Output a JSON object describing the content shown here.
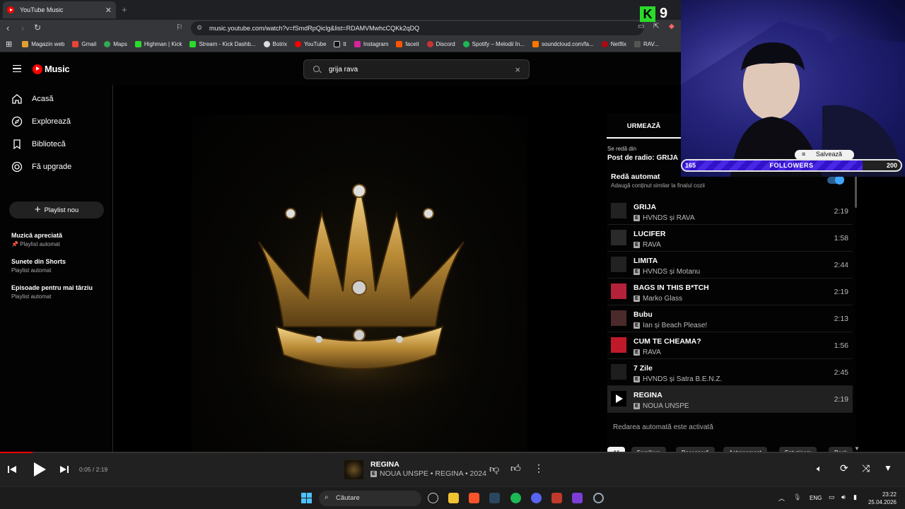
{
  "browser": {
    "tab_title": "YouTube Music",
    "url": "music.youtube.com/watch?v=fSmdRpQiclg&list=RDAMVMwhcCQKk2qDQ",
    "bookmarks": [
      "Magazin web",
      "Gmail",
      "Maps",
      "Highman | Kick",
      "Stream - Kick Dashb...",
      "Botrix",
      "YouTube",
      "tt",
      "Instagram",
      "faceit",
      "Discord",
      "Spotify – Melodii în...",
      "soundcloud.com/fa...",
      "Netflix",
      "RAV..."
    ]
  },
  "header": {
    "logo_text": "Music",
    "search_value": "grija rava",
    "search_clear": "×"
  },
  "sidebar": {
    "items": [
      {
        "label": "Acasă",
        "icon": "home-icon"
      },
      {
        "label": "Explorează",
        "icon": "compass-icon"
      },
      {
        "label": "Bibliotecă",
        "icon": "library-icon"
      },
      {
        "label": "Fă upgrade",
        "icon": "upgrade-icon"
      }
    ],
    "new_playlist": "Playlist nou",
    "playlists": [
      {
        "title": "Muzică apreciată",
        "subtitle": "Playlist automat",
        "pinned": true
      },
      {
        "title": "Sunete din Shorts",
        "subtitle": "Playlist automat"
      },
      {
        "title": "Episoade pentru mai târziu",
        "subtitle": "Playlist automat"
      }
    ]
  },
  "queue": {
    "tab": "URMEAZĂ",
    "playing_from_label": "Se redă din",
    "station": "Post de radio: GRIJA",
    "autoplay_title": "Redă automat",
    "autoplay_desc": "Adaugă conținut similar la finalul cozii",
    "autoplay_on": true,
    "tracks": [
      {
        "title": "GRIJA",
        "artist": "HVNDS și RAVA",
        "duration": "2:19"
      },
      {
        "title": "LUCIFER",
        "artist": "RAVA",
        "duration": "1:58"
      },
      {
        "title": "LIMITA",
        "artist": "HVNDS și Motanu",
        "duration": "2:44"
      },
      {
        "title": "BAGS IN THIS B*TCH",
        "artist": "Marko Glass",
        "duration": "2:19"
      },
      {
        "title": "Bubu",
        "artist": "Ian și Beach Please!",
        "duration": "2:13"
      },
      {
        "title": "CUM TE CHEAMA?",
        "artist": "RAVA",
        "duration": "1:56"
      },
      {
        "title": "7 Zile",
        "artist": "HVNDS și Satra B.E.N.Z.",
        "duration": "2:45"
      },
      {
        "title": "REGINA",
        "artist": "NOUA UNSPE",
        "duration": "2:19",
        "active": true
      }
    ],
    "explicit_badge": "E",
    "autoplay_note": "Redarea automată este activată",
    "chips": [
      "All",
      "Familiare",
      "Descoperă",
      "Antrenament",
      "Entuziasm",
      "Rock"
    ]
  },
  "player": {
    "time": "0:05 / 2:19",
    "progress": 0.036,
    "title": "REGINA",
    "subtitle": "NOUA UNSPE • REGINA • 2024"
  },
  "taskbar": {
    "search_placeholder": "Căutare",
    "lang": "ENG",
    "time": "23:22",
    "date": "25.04.2026"
  },
  "overlay": {
    "kick_letter": "K",
    "viewers": "9",
    "followers_label": "FOLLOWERS",
    "followers_current": "165",
    "followers_goal": "200",
    "save_label": "Salvează"
  },
  "colors": {
    "accent_red": "#ff0000",
    "toggle_blue": "#3ea6ff",
    "kick_green": "#2bdb2b",
    "goal_purple": "#3214c8"
  }
}
